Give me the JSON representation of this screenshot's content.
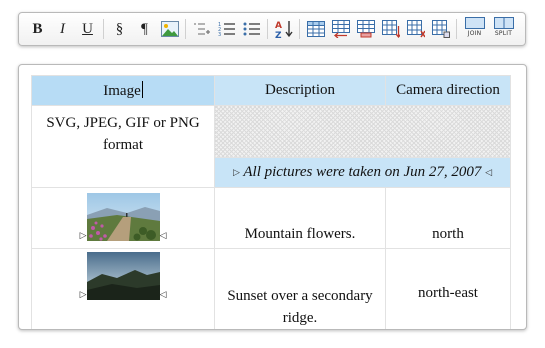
{
  "toolbar": {
    "bold": "B",
    "italic": "I",
    "underline": "U",
    "section": "§",
    "pilcrow": "¶",
    "join_label": "JOIN",
    "split_label": "SPLIT"
  },
  "table": {
    "headers": [
      "Image",
      "Description",
      "Camera direction"
    ],
    "format_note": "SVG, JPEG, GIF or PNG format",
    "caption": "All pictures were taken on Jun 27, 2007",
    "rows": [
      {
        "description": "Mountain flowers.",
        "direction": "north"
      },
      {
        "description": "Sunset over a secondary ridge.",
        "direction": "north-east"
      }
    ]
  }
}
